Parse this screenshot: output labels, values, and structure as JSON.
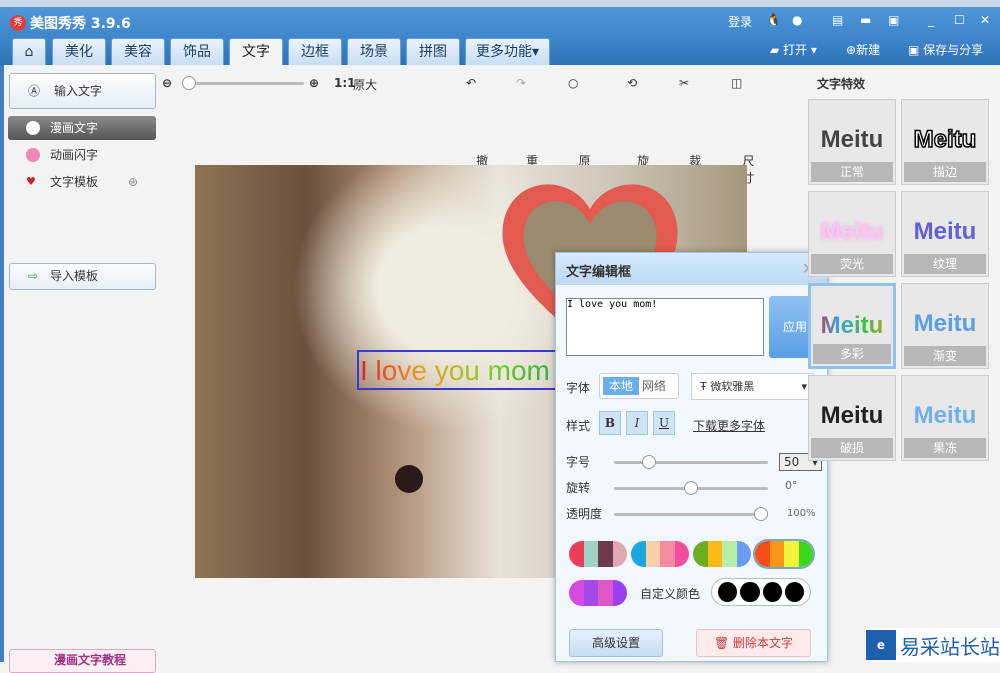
{
  "app": {
    "title": "美图秀秀 3.9.6",
    "logo": "秀"
  },
  "titlebar": {
    "login": "登录"
  },
  "tabs": [
    {
      "label": "美化"
    },
    {
      "label": "美容"
    },
    {
      "label": "饰品"
    },
    {
      "label": "文字",
      "active": true
    },
    {
      "label": "边框"
    },
    {
      "label": "场景"
    },
    {
      "label": "拼图"
    },
    {
      "label": "更多功能▾"
    }
  ],
  "top_actions": {
    "open": "打开",
    "new": "新建",
    "save": "保存与分享"
  },
  "toolbar": {
    "ratio": "1:1",
    "original_size": "原大",
    "undo": "撤销",
    "redo": "重做",
    "original": "原图",
    "rotate": "旋转",
    "crop": "裁剪",
    "size": "尺寸"
  },
  "left": {
    "input_text": "输入文字",
    "items": [
      {
        "label": "漫画文字"
      },
      {
        "label": "动画闪字"
      },
      {
        "label": "文字模板"
      }
    ],
    "import": "导入模板",
    "tutorial": "漫画文字教程"
  },
  "canvas": {
    "overlay_text": "I love you mom"
  },
  "dialog": {
    "title": "文字编辑框",
    "text_value": "I love you mom!",
    "apply": "应用",
    "font_label": "字体",
    "font_local": "本地",
    "font_web": "网络",
    "font_name": "微软雅黑",
    "style_label": "样式",
    "bold": "B",
    "italic": "I",
    "underline": "U",
    "download_fonts": "下载更多字体",
    "size_label": "字号",
    "size_value": "50",
    "rotate_label": "旋转",
    "rotate_value": "0°",
    "opacity_label": "透明度",
    "opacity_value": "100%",
    "size_slider": 0.2,
    "rotate_slider": 0.5,
    "opacity_slider": 1.0,
    "palettes": [
      [
        "#e8405a",
        "#9ed3c6",
        "#6e3a4e",
        "#e0a8b4"
      ],
      [
        "#1aa6e0",
        "#fbcfa8",
        "#f58aa0",
        "#f04fa0"
      ],
      [
        "#6cae22",
        "#fbb816",
        "#b6f0a8",
        "#6a9cf0"
      ],
      [
        "#f84e1a",
        "#f8961a",
        "#f4f43a",
        "#3cd81c"
      ],
      [
        "#d64ae0",
        "#a44ae8",
        "#e055c8",
        "#9a40f0"
      ]
    ],
    "custom_color_label": "自定义颜色",
    "advanced": "高级设置",
    "delete": "删除本文字"
  },
  "effects": {
    "title": "文字特效",
    "items": [
      {
        "label": "正常",
        "sample": "Meitu"
      },
      {
        "label": "描边",
        "sample": "Meitu"
      },
      {
        "label": "荧光",
        "sample": "Meitu"
      },
      {
        "label": "纹理",
        "sample": "Meitu"
      },
      {
        "label": "多彩",
        "sample": "Meitu",
        "selected": true
      },
      {
        "label": "渐变",
        "sample": "Meitu"
      },
      {
        "label": "破损",
        "sample": "Meitu"
      },
      {
        "label": "果冻",
        "sample": "Meitu"
      }
    ]
  },
  "watermark": {
    "text": "易采站长站"
  }
}
